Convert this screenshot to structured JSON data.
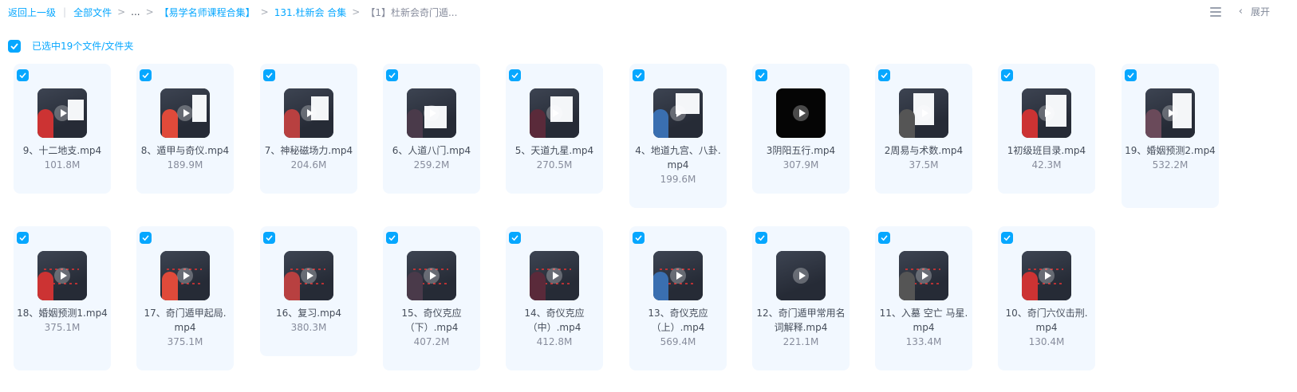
{
  "breadcrumb": {
    "back": "返回上一级",
    "all_files": "全部文件",
    "ellipsis": "...",
    "folder1": "【易学名师课程合集】",
    "folder2": "131.杜新会 合集",
    "current": "【1】杜新会奇门遁..."
  },
  "toolbar": {
    "expand_label": "展开",
    "expand_icon": "chevron-left-icon",
    "list_icon": "list-view-icon"
  },
  "selection": {
    "text": "已选中19个文件/文件夹",
    "checked": true
  },
  "colors": {
    "accent": "#06a7ff",
    "card_bg": "#f2f8ff",
    "text": "#454d5a",
    "subtext": "#878c9c"
  },
  "files": [
    {
      "name": "9、十二地支.mp4",
      "size": "101.8M",
      "thumb": "video-thumbnail"
    },
    {
      "name": "8、遁甲与奇仪.mp4",
      "size": "189.9M",
      "thumb": "video-thumbnail"
    },
    {
      "name": "7、神秘磁场力.mp4",
      "size": "204.6M",
      "thumb": "video-thumbnail"
    },
    {
      "name": "6、人道八门.mp4",
      "size": "259.2M",
      "thumb": "video-thumbnail"
    },
    {
      "name": "5、天道九星.mp4",
      "size": "270.5M",
      "thumb": "video-thumbnail"
    },
    {
      "name": "4、地道九宫、八卦.mp4",
      "size": "199.6M",
      "thumb": "video-thumbnail"
    },
    {
      "name": "3阴阳五行.mp4",
      "size": "307.9M",
      "thumb": "black-video-thumbnail"
    },
    {
      "name": "2周易与术数.mp4",
      "size": "37.5M",
      "thumb": "video-thumbnail"
    },
    {
      "name": "1初级班目录.mp4",
      "size": "42.3M",
      "thumb": "video-thumbnail"
    },
    {
      "name": "19、婚姻预测2.mp4",
      "size": "532.2M",
      "thumb": "video-thumbnail"
    },
    {
      "name": "18、婚姻预测1.mp4",
      "size": "375.1M",
      "thumb": "video-thumbnail"
    },
    {
      "name": "17、奇门遁甲起局.mp4",
      "size": "375.1M",
      "thumb": "video-thumbnail"
    },
    {
      "name": "16、复习.mp4",
      "size": "380.3M",
      "thumb": "video-thumbnail"
    },
    {
      "name": "15、奇仪克应（下）.mp4",
      "size": "407.2M",
      "thumb": "video-thumbnail"
    },
    {
      "name": "14、奇仪克应（中）.mp4",
      "size": "412.8M",
      "thumb": "video-thumbnail"
    },
    {
      "name": "13、奇仪克应（上）.mp4",
      "size": "569.4M",
      "thumb": "video-thumbnail"
    },
    {
      "name": "12、奇门遁甲常用名词解释.mp4",
      "size": "221.1M",
      "thumb": "video-thumbnail"
    },
    {
      "name": "11、入墓 空亡 马星.mp4",
      "size": "133.4M",
      "thumb": "video-thumbnail"
    },
    {
      "name": "10、奇门六仪击刑.mp4",
      "size": "130.4M",
      "thumb": "video-thumbnail"
    }
  ]
}
